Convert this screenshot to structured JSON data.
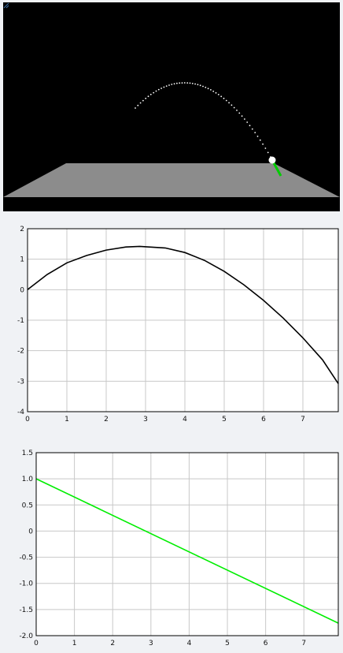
{
  "scene": {
    "background": "#000000",
    "floor_color": "#8c8c8c",
    "ball_color": "#ffffff",
    "velocity_arrow_color": "#00cc00",
    "trail_color": "#ffffff"
  },
  "chart_data": [
    {
      "type": "line",
      "title": "",
      "xlabel": "",
      "ylabel": "",
      "xlim": [
        0,
        7.9
      ],
      "ylim": [
        -4,
        2
      ],
      "x_ticks": [
        0,
        1,
        2,
        3,
        4,
        5,
        6,
        7
      ],
      "y_ticks": [
        2,
        1,
        0,
        -1,
        -2,
        -3,
        -4
      ],
      "x_tick_labels": [
        "0",
        "1",
        "2",
        "3",
        "4",
        "5",
        "6",
        "7"
      ],
      "y_tick_labels": [
        "2",
        "1",
        "0",
        "-1",
        "-2",
        "-3",
        "-4"
      ],
      "grid": true,
      "series": [
        {
          "color": "#000000",
          "x": [
            0,
            0.5,
            1,
            1.5,
            2,
            2.5,
            2.85,
            3.5,
            4,
            4.5,
            5,
            5.5,
            6,
            6.5,
            7,
            7.5,
            7.9
          ],
          "y": [
            0,
            0.5,
            0.88,
            1.12,
            1.3,
            1.4,
            1.42,
            1.37,
            1.22,
            0.96,
            0.6,
            0.16,
            -0.35,
            -0.93,
            -1.58,
            -2.3,
            -3.08
          ]
        }
      ]
    },
    {
      "type": "line",
      "title": "",
      "xlabel": "",
      "ylabel": "",
      "xlim": [
        0,
        7.9
      ],
      "ylim": [
        -2.0,
        1.5
      ],
      "x_ticks": [
        0,
        1,
        2,
        3,
        4,
        5,
        6,
        7
      ],
      "y_ticks": [
        1.5,
        1.0,
        0.5,
        0,
        -0.5,
        -1.0,
        -1.5,
        -2.0
      ],
      "x_tick_labels": [
        "0",
        "1",
        "2",
        "3",
        "4",
        "5",
        "6",
        "7"
      ],
      "y_tick_labels": [
        "1.5",
        "1.0",
        "0.5",
        "0",
        "-0.5",
        "-1.0",
        "-1.5",
        "-2.0"
      ],
      "grid": true,
      "series": [
        {
          "color": "#00ee00",
          "x": [
            0,
            7.9
          ],
          "y": [
            1.0,
            -1.76
          ]
        }
      ]
    }
  ]
}
